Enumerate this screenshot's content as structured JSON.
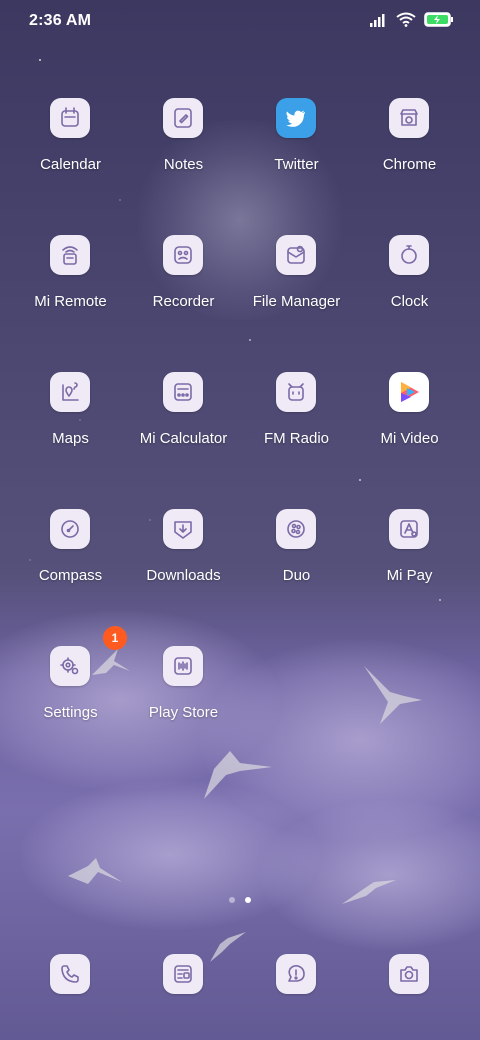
{
  "status": {
    "time": "2:36 AM",
    "icons": [
      "signal-icon",
      "wifi-icon",
      "battery-charging-icon"
    ]
  },
  "apps": [
    {
      "label": "Calendar",
      "icon": "calendar-icon"
    },
    {
      "label": "Notes",
      "icon": "notes-icon"
    },
    {
      "label": "Twitter",
      "icon": "twitter-icon"
    },
    {
      "label": "Chrome",
      "icon": "chrome-icon"
    },
    {
      "label": "Mi Remote",
      "icon": "remote-icon"
    },
    {
      "label": "Recorder",
      "icon": "recorder-icon"
    },
    {
      "label": "File Manager",
      "icon": "file-manager-icon"
    },
    {
      "label": "Clock",
      "icon": "clock-icon"
    },
    {
      "label": "Maps",
      "icon": "maps-icon"
    },
    {
      "label": "Mi Calculator",
      "icon": "calculator-icon"
    },
    {
      "label": "FM Radio",
      "icon": "radio-icon"
    },
    {
      "label": "Mi Video",
      "icon": "video-icon"
    },
    {
      "label": "Compass",
      "icon": "compass-icon"
    },
    {
      "label": "Downloads",
      "icon": "downloads-icon"
    },
    {
      "label": "Duo",
      "icon": "duo-icon"
    },
    {
      "label": "Mi Pay",
      "icon": "pay-icon"
    },
    {
      "label": "Settings",
      "icon": "settings-icon",
      "badge": "1"
    },
    {
      "label": "Play Store",
      "icon": "play-store-icon"
    }
  ],
  "page_indicator": {
    "pages": 2,
    "active": 2
  },
  "dock": [
    {
      "icon": "phone-icon"
    },
    {
      "icon": "messages-icon"
    },
    {
      "icon": "security-icon"
    },
    {
      "icon": "camera-icon"
    }
  ],
  "colors": {
    "icon_bg": "#efeaf6",
    "icon_stroke": "#7b6aa6",
    "badge": "#ff5a1f",
    "twitter": "#3ba0e8"
  }
}
